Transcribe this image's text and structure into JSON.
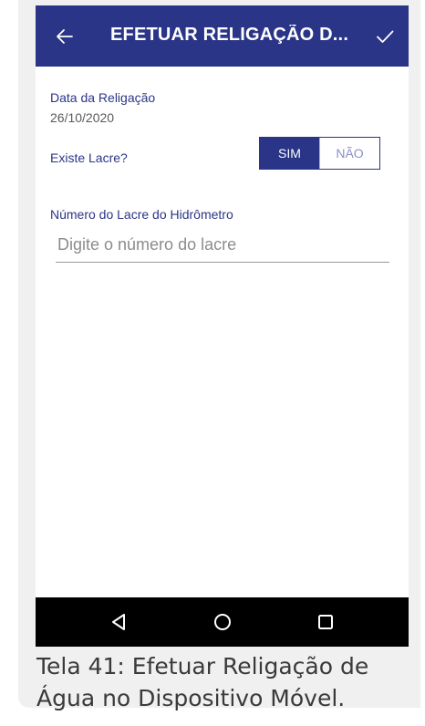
{
  "appbar": {
    "title": "EFETUAR RELIGAÇÃO D...",
    "background": "#2a3587",
    "back_icon": "arrow-left-icon",
    "confirm_icon": "check-icon"
  },
  "form": {
    "date_label": "Data da Religação",
    "date_value": "26/10/2020",
    "lacre_question": "Existe Lacre?",
    "toggle": {
      "options": [
        "SIM",
        "NÃO"
      ],
      "selected": "SIM"
    },
    "lacre_number_label": "Número do Lacre do Hidrômetro",
    "lacre_number_value": "",
    "lacre_number_placeholder": "Digite o número do lacre"
  },
  "navbar": {
    "buttons": [
      "back-triangle-icon",
      "home-circle-icon",
      "recents-square-icon"
    ]
  },
  "caption": "Tela 41: Efetuar Religação de Água no Dispositivo Móvel."
}
